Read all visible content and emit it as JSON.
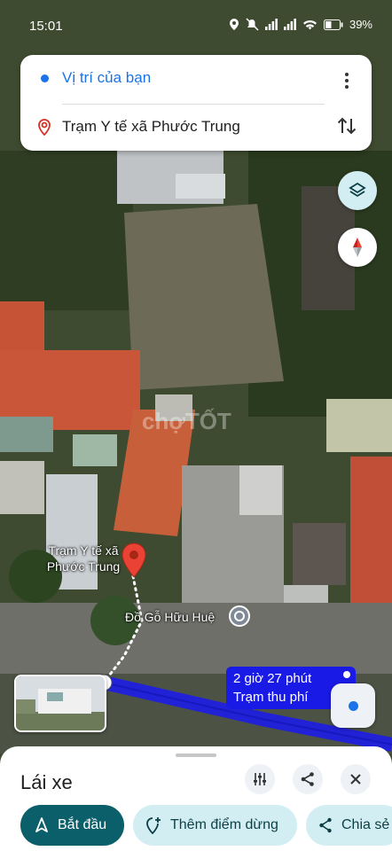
{
  "status_bar": {
    "time": "15:01",
    "battery": "39%",
    "icons": [
      "location-icon",
      "mute-icon",
      "signal-icon",
      "signal-icon",
      "wifi-icon",
      "battery-icon"
    ]
  },
  "route": {
    "origin_label": "Vị trí của bạn",
    "destination_label": "Trạm Y tế xã Phước Trung"
  },
  "map": {
    "destination_marker_label": "Trạm Y tế xã\nPhước Trung",
    "poi_label": "Đồ Gỗ Hữu Huệ",
    "watermark": "chợTỐT",
    "eta_line1": "2 giờ 27 phút",
    "eta_line2": "Trạm thu phí"
  },
  "sheet": {
    "title": "Lái xe",
    "actions": [
      {
        "label": "Bắt đầu",
        "icon": "navigation-arrow-icon"
      },
      {
        "label": "Thêm điểm dừng",
        "icon": "add-stop-icon"
      },
      {
        "label": "Chia sẻ",
        "icon": "share-icon"
      }
    ]
  },
  "colors": {
    "accent_blue": "#1a73e8",
    "route_line": "#2121d6",
    "primary_button": "#0b5f6b",
    "secondary_button": "#d3eef2"
  }
}
